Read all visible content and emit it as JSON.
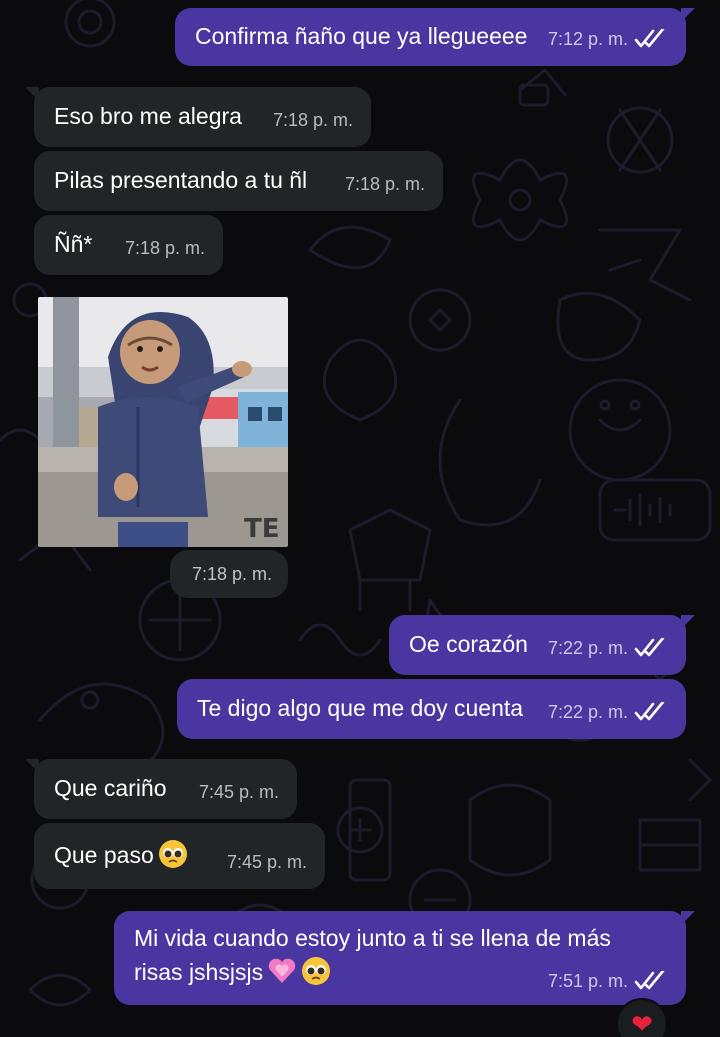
{
  "messages": [
    {
      "direction": "out",
      "text": "Confirma ñaño que ya llegueeee",
      "time": "7:12 p. m.",
      "status": "read"
    },
    {
      "direction": "in",
      "text": "Eso bro me alegra",
      "time": "7:18 p. m."
    },
    {
      "direction": "in",
      "text": "Pilas presentando a tu ñl",
      "time": "7:18 p. m."
    },
    {
      "direction": "in",
      "text": "Ññ*",
      "time": "7:18 p. m."
    },
    {
      "direction": "in",
      "type": "sticker",
      "sticker_text": "TE",
      "time": "7:18 p. m."
    },
    {
      "direction": "out",
      "text": "Oe corazón",
      "time": "7:22 p. m.",
      "status": "read"
    },
    {
      "direction": "out",
      "text": "Te digo algo que me doy cuenta",
      "time": "7:22 p. m.",
      "status": "read"
    },
    {
      "direction": "in",
      "text": "Que cariño",
      "time": "7:45 p. m."
    },
    {
      "direction": "in",
      "text": "Que paso",
      "emoji": "pleading-face",
      "time": "7:45 p. m."
    },
    {
      "direction": "out",
      "text": "Mi vida cuando estoy junto a ti se llena de más risas jshsjsjs",
      "emojis": [
        "growing-heart",
        "pleading-face"
      ],
      "time": "7:51 p. m.",
      "status": "read",
      "reaction": "❤"
    }
  ],
  "colors": {
    "background": "#0b0b0d",
    "outgoing_bubble": "#4a36a0",
    "incoming_bubble": "#212528",
    "wallpaper_line": "#1d1b2c",
    "reaction_heart": "#e8223a"
  }
}
